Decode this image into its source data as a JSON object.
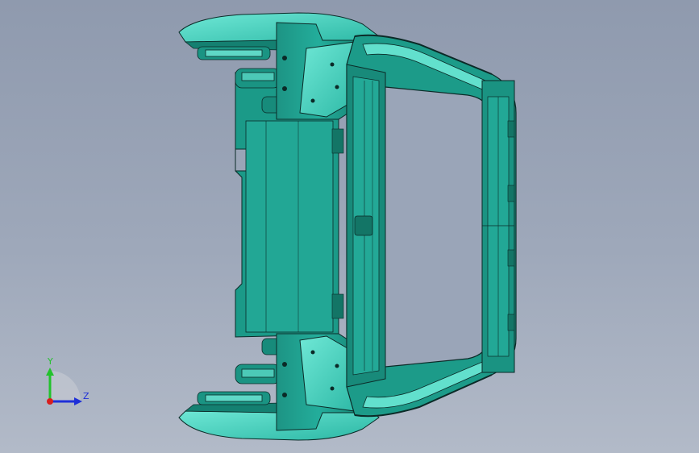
{
  "view": {
    "background_top": "#8f9aae",
    "background_bottom": "#b2bac8",
    "model_color": "#1fa08f",
    "model_highlight": "#5fe0cf",
    "edge_color": "#0b2a27"
  },
  "triad": {
    "y_label": "Y",
    "z_label": "Z",
    "y_color": "#22c22c",
    "z_color": "#1e2fd8",
    "x_color": "#d81e1e"
  }
}
